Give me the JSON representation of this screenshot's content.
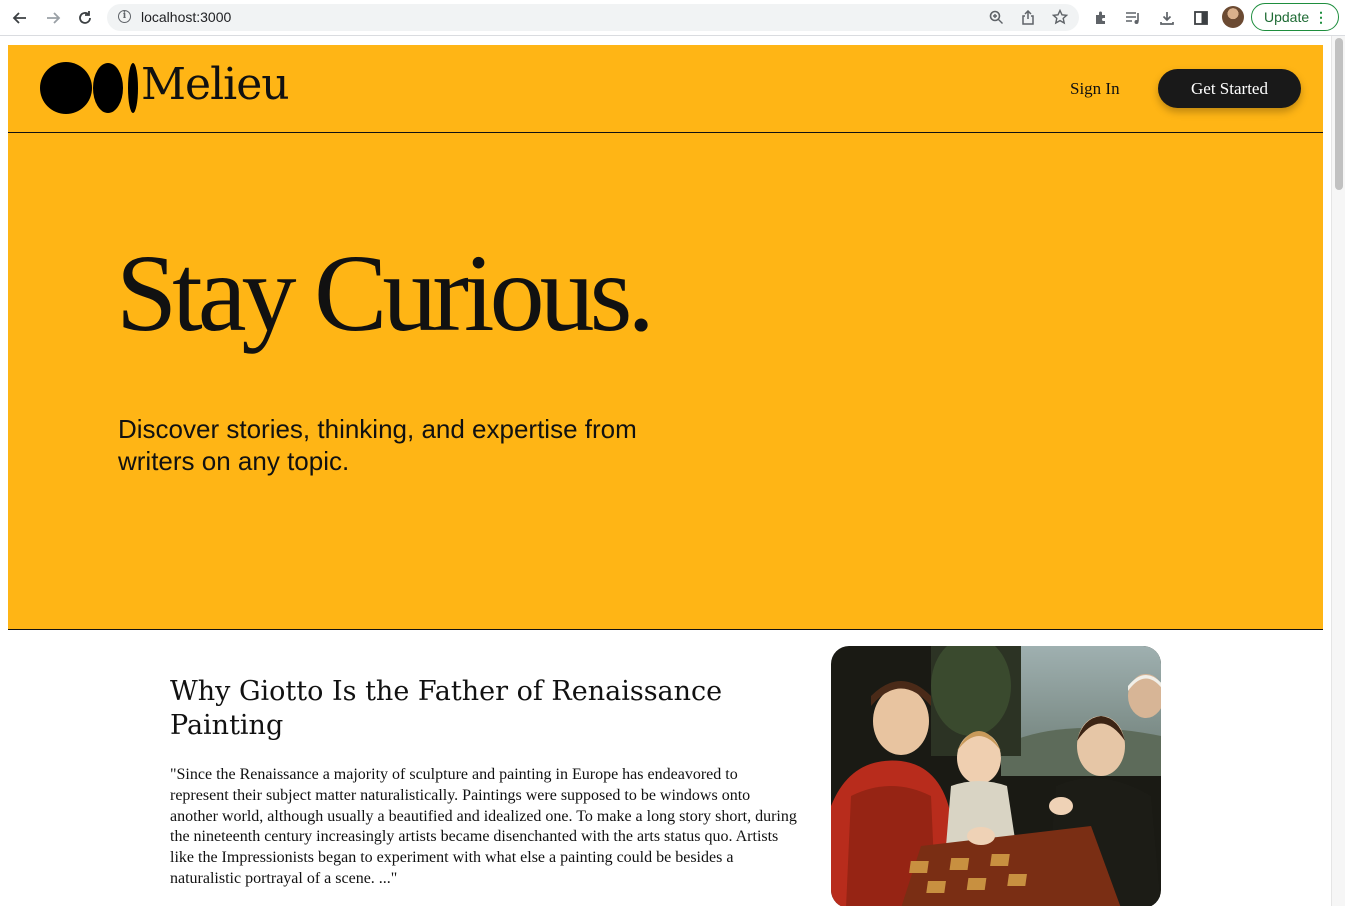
{
  "browser": {
    "url": "localhost:3000",
    "update_label": "Update",
    "icons": [
      "back-arrow-icon",
      "forward-arrow-icon",
      "reload-icon",
      "info-icon",
      "zoom-icon",
      "share-icon",
      "star-icon",
      "extensions-icon",
      "media-icon",
      "download-icon",
      "side-panel-icon",
      "profile-avatar",
      "more-icon"
    ]
  },
  "header": {
    "logo_text": "Melieu",
    "sign_in_label": "Sign In",
    "get_started_label": "Get Started"
  },
  "hero": {
    "title": "Stay Curious.",
    "subtitle": "Discover stories, thinking, and expertise from writers on any topic."
  },
  "article": {
    "title": "Why Giotto Is the Father of Renaissance Painting",
    "excerpt": "\"Since the Renaissance a majority of sculpture and painting in Europe has endeavored to represent their subject matter naturalistically. Paintings were supposed to be windows onto another world, although usually a beautified and idealized one. To make a long story short, during the nineteenth century increasingly artists became disenchanted with the arts status quo. Artists like the Impressionists began to experiment with what else a painting could be besides a naturalistic portrayal of a scene. ...\""
  },
  "colors": {
    "brand_yellow": "#ffb515",
    "dark_button": "#191919",
    "update_green": "#1e8e3e"
  }
}
